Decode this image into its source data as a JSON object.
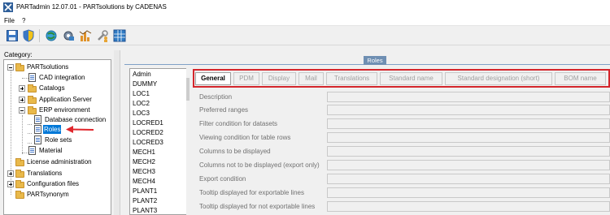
{
  "window": {
    "title": "PARTadmin 12.07.01 - PARTsolutions by CADENAS"
  },
  "menu": {
    "items": [
      "File",
      "?"
    ]
  },
  "toolbar": {
    "buttons": [
      "save-icon",
      "shield-icon",
      "globe-refresh-icon",
      "gear-tools-icon",
      "chart-icon",
      "tools-person-icon",
      "grid-table-icon"
    ]
  },
  "category": {
    "label": "Category:",
    "tree": [
      {
        "label": "PARTsolutions"
      },
      {
        "label": "CAD integration"
      },
      {
        "label": "Catalogs"
      },
      {
        "label": "Application Server"
      },
      {
        "label": "ERP environment"
      },
      {
        "label": "Database connection"
      },
      {
        "label": "Roles"
      },
      {
        "label": "Role sets"
      },
      {
        "label": "Material"
      },
      {
        "label": "License administration"
      },
      {
        "label": "Translations"
      },
      {
        "label": "Configuration files"
      },
      {
        "label": "PARTsynonym"
      }
    ]
  },
  "roles": {
    "header": "Roles",
    "list": [
      "Admin",
      "DUMMY",
      "LOC1",
      "LOC2",
      "LOC3",
      "LOCRED1",
      "LOCRED2",
      "LOCRED3",
      "MECH1",
      "MECH2",
      "MECH3",
      "MECH4",
      "PLANT1",
      "PLANT2",
      "PLANT3"
    ],
    "tabs": [
      "General",
      "PDM",
      "Display",
      "Mail",
      "Translations",
      "Standard name",
      "Standard designation (short)",
      "BOM name"
    ],
    "active_tab": "General",
    "fields": [
      {
        "label": "Description",
        "value": ""
      },
      {
        "label": "Preferred ranges",
        "value": ""
      },
      {
        "label": "Filter condition for datasets",
        "value": ""
      },
      {
        "label": "Viewing condition for table rows",
        "value": ""
      },
      {
        "label": "Columns to be displayed",
        "value": ""
      },
      {
        "label": "Columns not to be displayed (export only)",
        "value": ""
      },
      {
        "label": "Export condition",
        "value": ""
      },
      {
        "label": "Tooltip displayed for exportable lines",
        "value": ""
      },
      {
        "label": "Tooltip displayed for not exportable lines",
        "value": ""
      }
    ]
  },
  "colors": {
    "selection": "#0078d7",
    "highlight_border": "#d4262c",
    "arrow": "#e0262c",
    "group_header": "#6f8fb3"
  }
}
